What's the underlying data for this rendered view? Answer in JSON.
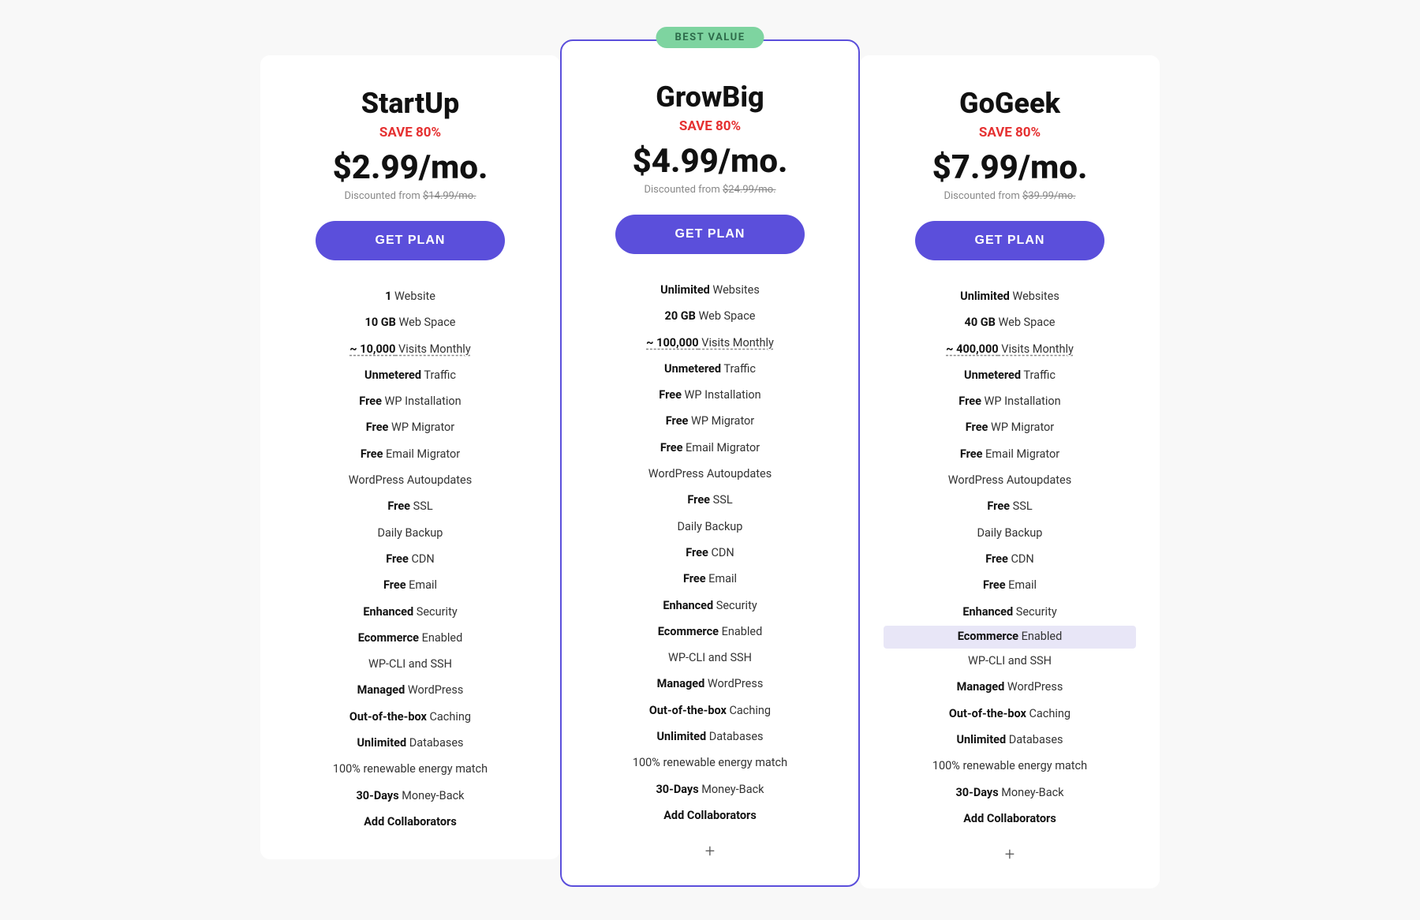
{
  "plans": [
    {
      "id": "startup",
      "name": "StartUp",
      "save": "SAVE 80%",
      "price": "$2.99/mo.",
      "discounted_from": "Discounted from $14.99/mo.",
      "cta": "GET PLAN",
      "featured": false,
      "best_value": false,
      "features": [
        {
          "bold": "1",
          "text": " Website",
          "style": ""
        },
        {
          "bold": "10 GB",
          "text": " Web Space",
          "style": ""
        },
        {
          "bold": "~ 10,000",
          "text": " Visits Monthly",
          "style": "visits"
        },
        {
          "bold": "Unmetered",
          "text": " Traffic",
          "style": ""
        },
        {
          "bold": "Free",
          "text": " WP Installation",
          "style": ""
        },
        {
          "bold": "Free",
          "text": " WP Migrator",
          "style": ""
        },
        {
          "bold": "Free",
          "text": " Email Migrator",
          "style": ""
        },
        {
          "bold": "",
          "text": "WordPress Autoupdates",
          "style": ""
        },
        {
          "bold": "Free",
          "text": " SSL",
          "style": ""
        },
        {
          "bold": "",
          "text": "Daily Backup",
          "style": ""
        },
        {
          "bold": "Free",
          "text": " CDN",
          "style": ""
        },
        {
          "bold": "Free",
          "text": " Email",
          "style": ""
        },
        {
          "bold": "Enhanced",
          "text": " Security",
          "style": ""
        },
        {
          "bold": "Ecommerce",
          "text": " Enabled",
          "style": ""
        },
        {
          "bold": "",
          "text": "WP-CLI and SSH",
          "style": ""
        },
        {
          "bold": "Managed",
          "text": " WordPress",
          "style": ""
        },
        {
          "bold": "Out-of-the-box",
          "text": " Caching",
          "style": ""
        },
        {
          "bold": "Unlimited",
          "text": " Databases",
          "style": ""
        },
        {
          "bold": "",
          "text": "100% renewable energy match",
          "style": ""
        },
        {
          "bold": "30-Days",
          "text": " Money-Back",
          "style": ""
        },
        {
          "bold": "Add Collaborators",
          "text": "",
          "style": ""
        }
      ],
      "show_plus": false
    },
    {
      "id": "growbig",
      "name": "GrowBig",
      "save": "SAVE 80%",
      "price": "$4.99/mo.",
      "discounted_from": "Discounted from $24.99/mo.",
      "cta": "GET PLAN",
      "featured": true,
      "best_value": true,
      "best_value_label": "BEST VALUE",
      "features": [
        {
          "bold": "Unlimited",
          "text": " Websites",
          "style": ""
        },
        {
          "bold": "20 GB",
          "text": " Web Space",
          "style": ""
        },
        {
          "bold": "~ 100,000",
          "text": " Visits Monthly",
          "style": "visits"
        },
        {
          "bold": "Unmetered",
          "text": " Traffic",
          "style": ""
        },
        {
          "bold": "Free",
          "text": " WP Installation",
          "style": ""
        },
        {
          "bold": "Free",
          "text": " WP Migrator",
          "style": ""
        },
        {
          "bold": "Free",
          "text": " Email Migrator",
          "style": ""
        },
        {
          "bold": "",
          "text": "WordPress Autoupdates",
          "style": ""
        },
        {
          "bold": "Free",
          "text": " SSL",
          "style": ""
        },
        {
          "bold": "",
          "text": "Daily Backup",
          "style": ""
        },
        {
          "bold": "Free",
          "text": " CDN",
          "style": ""
        },
        {
          "bold": "Free",
          "text": " Email",
          "style": ""
        },
        {
          "bold": "Enhanced",
          "text": " Security",
          "style": ""
        },
        {
          "bold": "Ecommerce",
          "text": " Enabled",
          "style": ""
        },
        {
          "bold": "",
          "text": "WP-CLI and SSH",
          "style": ""
        },
        {
          "bold": "Managed",
          "text": " WordPress",
          "style": ""
        },
        {
          "bold": "Out-of-the-box",
          "text": " Caching",
          "style": ""
        },
        {
          "bold": "Unlimited",
          "text": " Databases",
          "style": ""
        },
        {
          "bold": "",
          "text": "100% renewable energy match",
          "style": ""
        },
        {
          "bold": "30-Days",
          "text": " Money-Back",
          "style": ""
        },
        {
          "bold": "Add Collaborators",
          "text": "",
          "style": ""
        }
      ],
      "show_plus": true
    },
    {
      "id": "gogeek",
      "name": "GoGeek",
      "save": "SAVE 80%",
      "price": "$7.99/mo.",
      "discounted_from": "Discounted from $39.99/mo.",
      "cta": "GET PLAN",
      "featured": false,
      "best_value": false,
      "features": [
        {
          "bold": "Unlimited",
          "text": " Websites",
          "style": ""
        },
        {
          "bold": "40 GB",
          "text": " Web Space",
          "style": ""
        },
        {
          "bold": "~ 400,000",
          "text": " Visits Monthly",
          "style": "visits"
        },
        {
          "bold": "Unmetered",
          "text": " Traffic",
          "style": ""
        },
        {
          "bold": "Free",
          "text": " WP Installation",
          "style": ""
        },
        {
          "bold": "Free",
          "text": " WP Migrator",
          "style": ""
        },
        {
          "bold": "Free",
          "text": " Email Migrator",
          "style": ""
        },
        {
          "bold": "",
          "text": "WordPress Autoupdates",
          "style": ""
        },
        {
          "bold": "Free",
          "text": " SSL",
          "style": ""
        },
        {
          "bold": "",
          "text": "Daily Backup",
          "style": ""
        },
        {
          "bold": "Free",
          "text": " CDN",
          "style": ""
        },
        {
          "bold": "Free",
          "text": " Email",
          "style": ""
        },
        {
          "bold": "Enhanced",
          "text": " Security",
          "style": ""
        },
        {
          "bold": "Ecommerce",
          "text": " Enabled",
          "style": "highlight"
        },
        {
          "bold": "",
          "text": "WP-CLI and SSH",
          "style": ""
        },
        {
          "bold": "Managed",
          "text": " WordPress",
          "style": ""
        },
        {
          "bold": "Out-of-the-box",
          "text": " Caching",
          "style": ""
        },
        {
          "bold": "Unlimited",
          "text": " Databases",
          "style": ""
        },
        {
          "bold": "",
          "text": "100% renewable energy match",
          "style": ""
        },
        {
          "bold": "30-Days",
          "text": " Money-Back",
          "style": ""
        },
        {
          "bold": "Add Collaborators",
          "text": "",
          "style": ""
        }
      ],
      "show_plus": true
    }
  ]
}
